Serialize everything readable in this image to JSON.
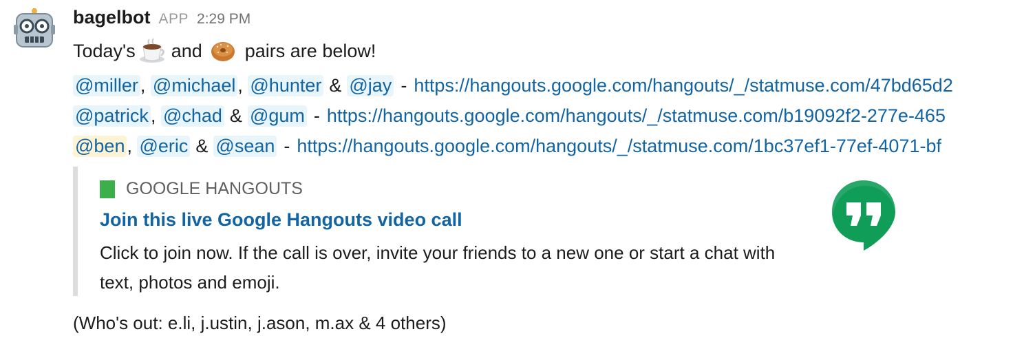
{
  "message": {
    "author": "bagelbot",
    "app_badge": "APP",
    "time": "2:29 PM",
    "avatar_icon": "robot-face-icon",
    "intro": {
      "before": "Today's",
      "coffee_icon": "coffee-emoji-icon",
      "middle": "and",
      "bagel_icon": "bagel-emoji-icon",
      "after": "pairs are below!"
    },
    "pairs": [
      {
        "mentions": [
          "@miller",
          "@michael",
          "@hunter",
          "@jay"
        ],
        "link": "https://hangouts.google.com/hangouts/_/statmuse.com/47bd65d2"
      },
      {
        "mentions": [
          "@patrick",
          "@chad",
          "@gum"
        ],
        "link": "https://hangouts.google.com/hangouts/_/statmuse.com/b19092f2-277e-465"
      },
      {
        "mentions": [
          "@ben",
          "@eric",
          "@sean"
        ],
        "link": "https://hangouts.google.com/hangouts/_/statmuse.com/1bc37ef1-77ef-4071-bf"
      }
    ],
    "attachment": {
      "provider": "GOOGLE HANGOUTS",
      "title": "Join this live Google Hangouts video call",
      "description": "Click to join now. If the call is over, invite your friends to a new one or start a chat with text, photos and emoji.",
      "logo_icon": "google-hangouts-logo-icon",
      "provider_color": "#3cae4a"
    },
    "footer": "(Who's out: e.li, j.ustin, j.ason, m.ax & 4 others)"
  },
  "colors": {
    "link": "#1264a3",
    "mention_bg": "#e8f5fa",
    "self_mention_bg": "#fef4d5",
    "hangouts_green": "#0f9d58"
  }
}
